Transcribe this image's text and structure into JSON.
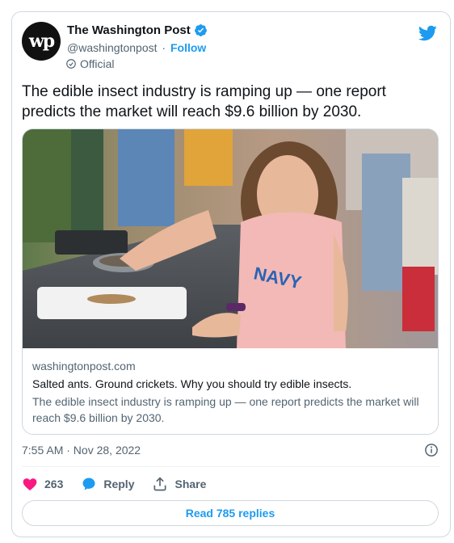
{
  "account": {
    "avatar_text": "wp",
    "name": "The Washington Post",
    "handle": "@washingtonpost",
    "separator": "·",
    "follow_label": "Follow",
    "official_label": "Official"
  },
  "tweet": {
    "text": "The edible insect industry is ramping up — one report predicts the market will reach $9.6 billion by 2030."
  },
  "card": {
    "domain": "washingtonpost.com",
    "headline": "Salted ants. Ground crickets. Why you should try edible insects.",
    "description": "The edible insect industry is ramping up — one report predicts the market will reach $9.6 billion by 2030.",
    "shirt_text": "NAVY"
  },
  "meta": {
    "timestamp": "7:55 AM · Nov 28, 2022"
  },
  "actions": {
    "like_count": "263",
    "reply_label": "Reply",
    "share_label": "Share"
  },
  "replies_button": {
    "label": "Read 785 replies"
  },
  "colors": {
    "brand_blue": "#1d9bf0",
    "like_pink": "#f91880",
    "text_primary": "#0f1419",
    "text_secondary": "#536471",
    "border": "#cfd9de"
  },
  "icons": [
    "verified-badge-icon",
    "twitter-bird-icon",
    "official-check-icon",
    "info-icon",
    "heart-icon",
    "reply-bubble-icon",
    "share-icon"
  ]
}
